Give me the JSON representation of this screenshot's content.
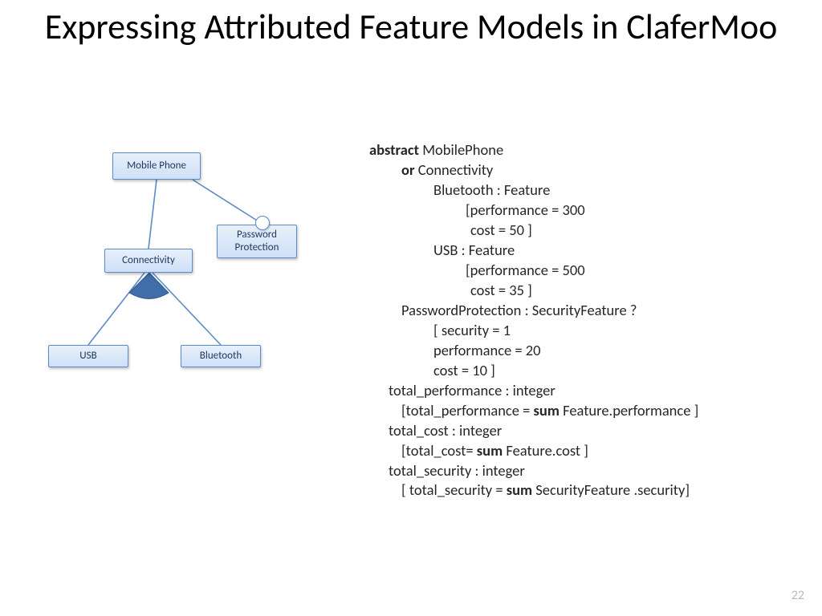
{
  "title": "Expressing Attributed Feature Models in ClaferMoo",
  "page_number": "22",
  "diagram": {
    "mobile": "Mobile Phone",
    "connectivity": "Connectivity",
    "password": "Password Protection",
    "usb": "USB",
    "bluetooth": "Bluetooth"
  },
  "code": {
    "l1a": "abstract",
    "l1b": " MobilePhone",
    "l2a": "or",
    "l2b": " Connectivity",
    "l3": "Bluetooth : Feature",
    "l4": "[performance = 300",
    "l5": " cost = 50 ]",
    "l6": "USB : Feature",
    "l7": "[performance = 500",
    "l8": " cost = 35 ]",
    "l9": "PasswordProtection : SecurityFeature ?",
    "l10": "[ security = 1",
    "l11": "  performance = 20",
    "l12": " cost = 10 ]",
    "l13": "total_performance : integer",
    "l14a": "[total_performance = ",
    "l14b": "sum",
    "l14c": " Feature.performance ]",
    "l15": "total_cost : integer",
    "l16a": "[total_cost= ",
    "l16b": "sum",
    "l16c": " Feature.cost ]",
    "l17": "total_security : integer",
    "l18a": "[ total_security = ",
    "l18b": "sum",
    "l18c": " SecurityFeature .security]"
  }
}
